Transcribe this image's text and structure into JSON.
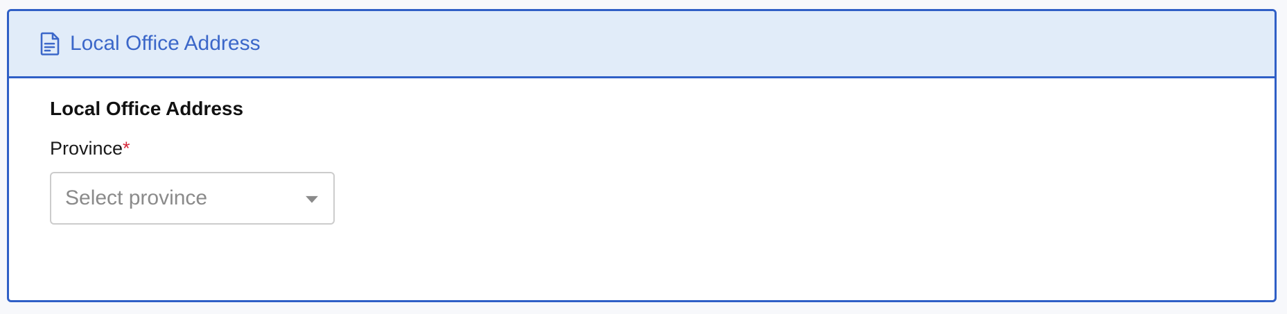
{
  "card": {
    "header_title": "Local Office Address",
    "header_icon": "document-icon"
  },
  "section": {
    "title": "Local Office Address"
  },
  "province": {
    "label": "Province",
    "required_mark": "*",
    "placeholder": "Select province",
    "caret_icon": "chevron-down-icon"
  },
  "colors": {
    "accent": "#2f5fc6",
    "header_bg": "#e1ecf9",
    "header_text": "#3b67c9",
    "required": "#d6283a",
    "placeholder": "#8a8a8a"
  }
}
